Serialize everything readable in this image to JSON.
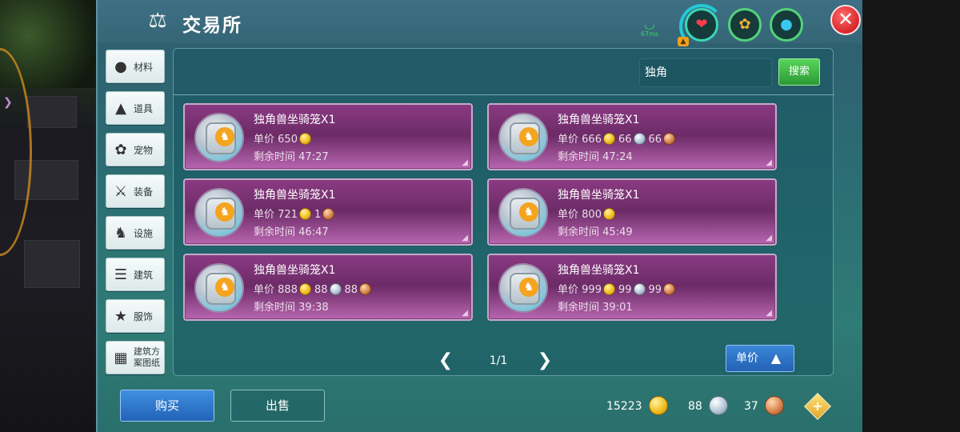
{
  "header": {
    "title": "交易所",
    "ping": "67ms",
    "title_icon": "scale-icon"
  },
  "stats": {
    "health_icon": "heart-icon",
    "hunger_icon": "food-icon",
    "thirst_icon": "water-drop-icon"
  },
  "categories": [
    {
      "label": "材料",
      "icon": "materials-icon"
    },
    {
      "label": "道具",
      "icon": "tool-icon"
    },
    {
      "label": "宠物",
      "icon": "paw-icon"
    },
    {
      "label": "装备",
      "icon": "equipment-icon"
    },
    {
      "label": "设施",
      "icon": "facility-icon"
    },
    {
      "label": "建筑",
      "icon": "building-icon"
    },
    {
      "label": "服饰",
      "icon": "clothing-icon"
    },
    {
      "label": "建筑方案图纸",
      "icon": "blueprint-icon"
    }
  ],
  "search": {
    "value": "独角",
    "button_label": "搜索"
  },
  "listing_labels": {
    "price": "单价",
    "time_left": "剩余时间"
  },
  "listings": [
    {
      "name": "独角兽坐骑笼X1",
      "gold": "650",
      "silver": "",
      "copper": "",
      "time": "47:27"
    },
    {
      "name": "独角兽坐骑笼X1",
      "gold": "666",
      "silver": "66",
      "copper": "66",
      "time": "47:24"
    },
    {
      "name": "独角兽坐骑笼X1",
      "gold": "721",
      "silver": "",
      "copper": "1",
      "time": "46:47"
    },
    {
      "name": "独角兽坐骑笼X1",
      "gold": "800",
      "silver": "",
      "copper": "",
      "time": "45:49"
    },
    {
      "name": "独角兽坐骑笼X1",
      "gold": "888",
      "silver": "88",
      "copper": "88",
      "time": "39:38"
    },
    {
      "name": "独角兽坐骑笼X1",
      "gold": "999",
      "silver": "99",
      "copper": "99",
      "time": "39:01"
    }
  ],
  "pager": {
    "page": "1/1",
    "prev_icon": "chevron-left-icon",
    "next_icon": "chevron-right-icon"
  },
  "sort": {
    "label": "单价"
  },
  "actions": {
    "buy_label": "购买",
    "sell_label": "出售"
  },
  "wallet": {
    "gold": "15223",
    "silver": "88",
    "copper": "37"
  },
  "colors": {
    "panel": "#2f6b72",
    "card": "#7a3272",
    "accent_blue": "#2f74c8",
    "search_green": "#3fae43"
  }
}
